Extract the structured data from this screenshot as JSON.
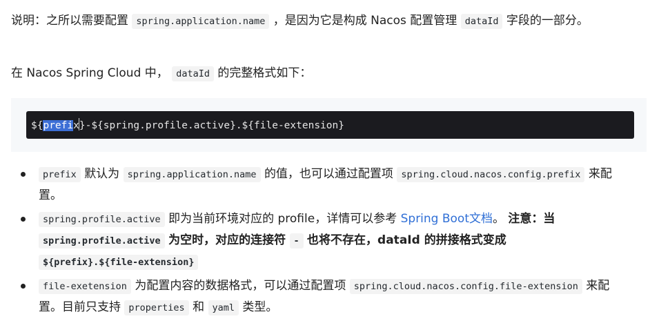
{
  "para1": {
    "t1": "说明：之所以需要配置",
    "code1": "spring.application.name",
    "t2": "，是因为它是构成 Nacos 配置管理",
    "code2": "dataId",
    "t3": "字段的一部分。"
  },
  "para2": {
    "t1": "在 Nacos Spring Cloud 中，",
    "code1": "dataId",
    "t2": "的完整格式如下："
  },
  "code_block": {
    "prefix_open": "${",
    "highlight": "prefi",
    "after_caret": "x",
    "rest": "}-${spring.profile.active}.${file-extension}"
  },
  "bullets": [
    {
      "code1": "prefix",
      "t1": "默认为",
      "code2": "spring.application.name",
      "t2": "的值，也可以通过配置项",
      "code3": "spring.cloud.nacos.config.prefix",
      "t3": "来配置。"
    },
    {
      "code1": "spring.profile.active",
      "t1": "即为当前环境对应的 profile，详情可以参考",
      "link": "Spring Boot文档",
      "t2": "。",
      "b1": "注意：当",
      "bcode1": "spring.profile.active",
      "b2": "为空时，对应的连接符",
      "bcode2": "-",
      "b3": "也将不存在，dataId 的拼接格式变成",
      "bcode3": "${prefix}.${file-extension}"
    },
    {
      "code1": "file-exetension",
      "t1": "为配置内容的数据格式，可以通过配置项",
      "code2": "spring.cloud.nacos.config.file-extension",
      "t2": "来配置。目前只支持",
      "code3": "properties",
      "t3": "和",
      "code4": "yaml",
      "t4": "类型。"
    }
  ]
}
